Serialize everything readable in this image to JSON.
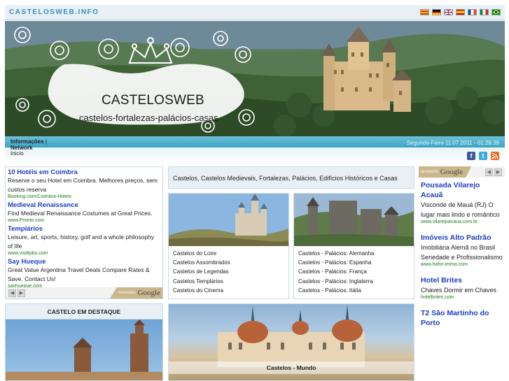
{
  "colors": {
    "accent": "#3a8cc0",
    "link": "#1d3fbf",
    "ad_url": "#1d7a1d",
    "panel": "#e8f0f6"
  },
  "site": {
    "name": "CASTELOSWEB.INFO"
  },
  "flags": [
    "catalan-flag",
    "german-flag",
    "uk-flag",
    "spanish-flag",
    "french-flag",
    "italian-flag",
    "brazil-flag"
  ],
  "banner": {
    "title": "CASTELOSWEB",
    "subtitle": "castelos-fortalezas-palácios-casas"
  },
  "nav": {
    "informacoes": "Informações",
    "separator": "|",
    "network": "Network",
    "inicio": "Inicio",
    "datetime": "Segunda-Feira 11.07.2011 - 01:28:39"
  },
  "social": [
    "facebook-icon",
    "twitter-icon",
    "rss-icon"
  ],
  "left_ads": {
    "items": [
      {
        "title": "10 Hotéis em Coimbra",
        "body": "Reserve o seu Hotel em Coimbra. Melhores preços, sem custos reserva",
        "url": "Booking.com/Coimbra-Hotels"
      },
      {
        "title": "Medieval Renaissance",
        "body": "Find Medieval Renaissance Costumes at Great Prices.",
        "url": "www.Pronto.com"
      },
      {
        "title": "Templários",
        "body": "Leisure, art, sports, history, golf and a whole philosophy of life",
        "url": "www.visitfpbo.com"
      },
      {
        "title": "Say Hueque",
        "body": "Great Value Argentina Travel Deals Compare Rates & Save. Contact Us!",
        "url": "sayhueque.com"
      }
    ],
    "badge_small": "Anúncios",
    "badge_word": "Google"
  },
  "center": {
    "title": "Castelos, Castelos Medievais, Fortalezas, Palácios, Edifícios Históricos e Casas",
    "card_left": [
      "Castelos do Loire",
      "Castelos Assombrados",
      "Castelos de Legendas",
      "Castelos Templários",
      "Castelos do Cinema"
    ],
    "card_right": [
      "Castelos - Palácios: Alemanha",
      "Castelos - Palácios: Espanha",
      "Castelos - Palácios: França",
      "Castelos - Palácios: Inglaterra",
      "Castelos - Palácios: Itália"
    ],
    "mundo_caption": "Castelos - Mundo"
  },
  "destaque": {
    "heading": "CASTELO EM DESTAQUE"
  },
  "right_ads": {
    "badge_small": "Anúncios",
    "badge_word": "Google",
    "items": [
      {
        "title": "Pousada Vilarejo Acauã",
        "body": "Visconde de Mauá (RJ) O lugar mais lindo e romântico",
        "url": "www.vilarejoacaua.com.br"
      },
      {
        "title": "Imóveis Alto Padrão",
        "body": "Imobiliária Alemã no Brasil Seriedade e Profissionalismo",
        "url": "www.hahn-immo.com"
      },
      {
        "title": "Hotel Brites",
        "body": "Chaves Dormir em Chaves",
        "url": "hotelbrites.com"
      },
      {
        "title": "T2 São Martinho do Porto",
        "body": "",
        "url": ""
      }
    ]
  }
}
